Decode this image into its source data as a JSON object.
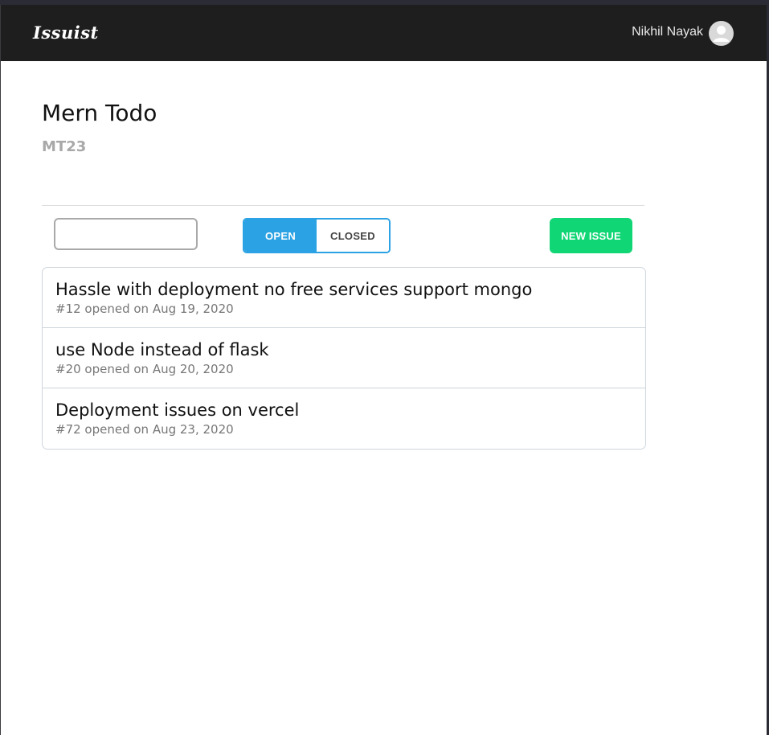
{
  "header": {
    "brand": "Issuist",
    "user_name": "Nikhil Nayak",
    "avatar_icon": "user-avatar-icon"
  },
  "project": {
    "title": "Mern Todo",
    "code": "MT23"
  },
  "toolbar": {
    "search_value": "",
    "filter_open_label": "OPEN",
    "filter_closed_label": "CLOSED",
    "active_filter": "OPEN",
    "new_issue_label": "NEW ISSUE"
  },
  "issues": [
    {
      "title": "Hassle with deployment no free services support mongo",
      "meta": "#12 opened on Aug 19, 2020"
    },
    {
      "title": "use Node instead of flask",
      "meta": "#20 opened on Aug 20, 2020"
    },
    {
      "title": "Deployment issues on vercel",
      "meta": "#72 opened on Aug 23, 2020"
    }
  ],
  "colors": {
    "navbar": "#1e1e1e",
    "accent": "#2aa2e3",
    "new_issue": "#11d675",
    "muted": "#777777"
  }
}
